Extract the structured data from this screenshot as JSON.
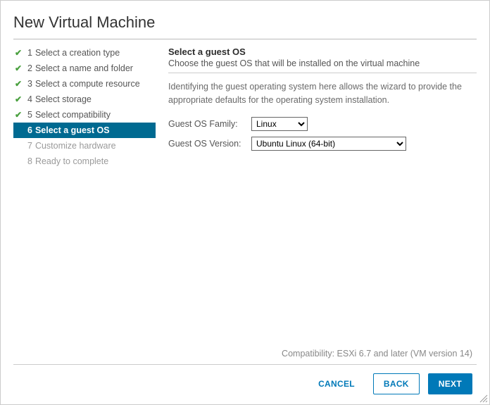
{
  "title": "New Virtual Machine",
  "steps": [
    {
      "num": "1",
      "label": "Select a creation type",
      "state": "done"
    },
    {
      "num": "2",
      "label": "Select a name and folder",
      "state": "done"
    },
    {
      "num": "3",
      "label": "Select a compute resource",
      "state": "done"
    },
    {
      "num": "4",
      "label": "Select storage",
      "state": "done"
    },
    {
      "num": "5",
      "label": "Select compatibility",
      "state": "done"
    },
    {
      "num": "6",
      "label": "Select a guest OS",
      "state": "active"
    },
    {
      "num": "7",
      "label": "Customize hardware",
      "state": "pending"
    },
    {
      "num": "8",
      "label": "Ready to complete",
      "state": "pending"
    }
  ],
  "content": {
    "heading": "Select a guest OS",
    "subheading": "Choose the guest OS that will be installed on the virtual machine",
    "description": "Identifying the guest operating system here allows the wizard to provide the appropriate defaults for the operating system installation.",
    "family_label": "Guest OS Family:",
    "family_value": "Linux",
    "version_label": "Guest OS Version:",
    "version_value": "Ubuntu Linux (64-bit)"
  },
  "compat_note": "Compatibility: ESXi 6.7 and later (VM version 14)",
  "buttons": {
    "cancel": "CANCEL",
    "back": "BACK",
    "next": "NEXT"
  }
}
